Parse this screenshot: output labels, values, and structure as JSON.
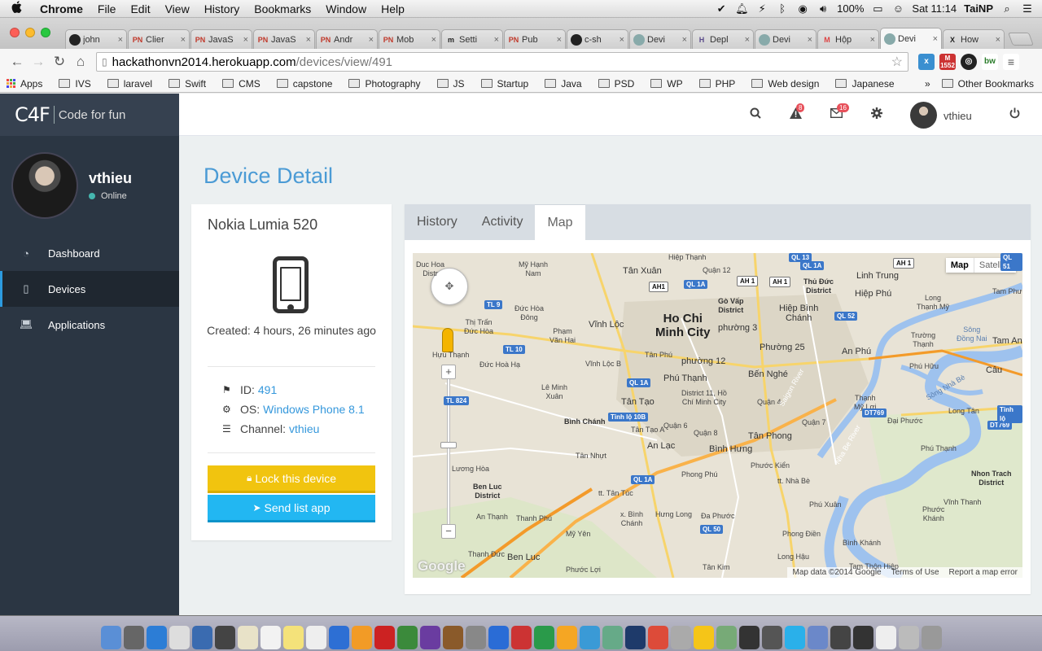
{
  "menubar": {
    "apple": "",
    "app": "Chrome",
    "items": [
      "File",
      "Edit",
      "View",
      "History",
      "Bookmarks",
      "Window",
      "Help"
    ],
    "battery": "100%",
    "clock": "Sat 11:14",
    "user": "TaiNP"
  },
  "browser": {
    "tabs": [
      {
        "label": "john",
        "icon": "github-icon",
        "favtext": "",
        "favcolor": "#222"
      },
      {
        "label": "Clier",
        "icon": "pn-icon",
        "favtext": "PN",
        "favcolor": "#c0392b"
      },
      {
        "label": "JavaS",
        "icon": "pn-icon",
        "favtext": "PN",
        "favcolor": "#c0392b"
      },
      {
        "label": "JavaS",
        "icon": "pn-icon",
        "favtext": "PN",
        "favcolor": "#c0392b"
      },
      {
        "label": "Andr",
        "icon": "pn-icon",
        "favtext": "PN",
        "favcolor": "#c0392b"
      },
      {
        "label": "Mob",
        "icon": "pn-icon",
        "favtext": "PN",
        "favcolor": "#c0392b"
      },
      {
        "label": "Setti",
        "icon": "m-icon",
        "favtext": "m",
        "favcolor": "#222"
      },
      {
        "label": "Pub",
        "icon": "pn-icon",
        "favtext": "PN",
        "favcolor": "#c0392b"
      },
      {
        "label": "c-sh",
        "icon": "github-icon",
        "favtext": "",
        "favcolor": "#222"
      },
      {
        "label": "Devi",
        "icon": "page-icon",
        "favtext": "",
        "favcolor": "#8aa"
      },
      {
        "label": "Depl",
        "icon": "heroku-icon",
        "favtext": "H",
        "favcolor": "#5a4a8a"
      },
      {
        "label": "Devi",
        "icon": "page-icon",
        "favtext": "",
        "favcolor": "#8aa"
      },
      {
        "label": "Hộp",
        "icon": "gmail-icon",
        "favtext": "M",
        "favcolor": "#d44"
      },
      {
        "label": "Devi",
        "icon": "page-icon",
        "favtext": "",
        "favcolor": "#8aa"
      },
      {
        "label": "How",
        "icon": "x-icon",
        "favtext": "X",
        "favcolor": "#222"
      }
    ],
    "active_tab": 13,
    "url_host": "hackathonvn2014.herokuapp.com",
    "url_path": "/devices/view/491",
    "gmail_count": "1552",
    "bookmarks": [
      "IVS",
      "laravel",
      "Swift",
      "CMS",
      "capstone",
      "Photography",
      "JS",
      "Startup",
      "Java",
      "PSD",
      "WP",
      "PHP",
      "Web design",
      "Japanese"
    ],
    "apps_label": "Apps",
    "overflow_label": "»",
    "other_bookmarks": "Other Bookmarks"
  },
  "app": {
    "logo_mark": "C4F",
    "logo_text": "Code for fun",
    "user": {
      "name": "vthieu",
      "status": "Online"
    },
    "nav": [
      {
        "label": "Dashboard",
        "icon": "dashboard-icon"
      },
      {
        "label": "Devices",
        "icon": "mobile-icon"
      },
      {
        "label": "Applications",
        "icon": "laptop-icon"
      }
    ],
    "active_nav": 1,
    "topbar": {
      "alerts_count": "8",
      "messages_count": "16",
      "username": "vthieu"
    },
    "page_title": "Device Detail",
    "device": {
      "name": "Nokia Lumia 520",
      "created": "Created: 4 hours, 26 minutes ago",
      "id_label": "ID:",
      "id_value": "491",
      "os_label": "OS:",
      "os_value": "Windows Phone 8.1",
      "channel_label": "Channel:",
      "channel_value": "vthieu"
    },
    "buttons": {
      "lock": "Lock this device",
      "send": "Send list app"
    },
    "tabs": [
      "History",
      "Activity",
      "Map"
    ],
    "active_tab": 2,
    "map": {
      "type_map": "Map",
      "type_satellite": "Satellite",
      "google": "Google",
      "attribution": [
        "Map data ©2014 Google",
        "Terms of Use",
        "Report a map error"
      ],
      "labels": {
        "city": "Ho Chi\nMinh City",
        "duc_hoa": "Duc Hoa\nDistr",
        "my_hanh_nam": "Mỹ Hạnh\nNam",
        "tan_xuan": "Tân Xuân",
        "hiep_thanh": "Hiệp Thạnh",
        "quan12": "Quận 12",
        "thu_duc": "Thủ Đức\nDistrict",
        "linh_trung": "Linh Trung",
        "tam_phuoc": "Tam Phướ",
        "go_vap": "Gò Vấp\nDistrict",
        "hiep_binh": "Hiệp Bình\nChánh",
        "hiep_phu": "Hiệp Phú",
        "long_thanh_my": "Long\nThạnh Mỹ",
        "duc_hoa_dong": "Đức Hòa\nĐông",
        "thi_tran": "Thị Trấn\nĐức Hòa",
        "pham_van_hai": "Phạm\nVăn Hai",
        "vinh_loc": "Vĩnh Lộc",
        "phuong3": "phường 3",
        "truong_thanh": "Trường\nThạnh",
        "tam_an": "Tam An",
        "hau_thanh": "Hựu Thạnh",
        "tan_phu": "Tân Phú",
        "phuong12": "phường 12",
        "phuong25": "Phường 25",
        "an_phu": "An Phú",
        "duc_hoa_ha": "Đức Hoà Hạ",
        "vinh_loc_b": "Vĩnh Lộc B",
        "ben_nghe": "Bến Nghé",
        "phu_huu": "Phú Hữu",
        "cau": "Câu",
        "le_minh_xuan": "Lê Minh\nXuân",
        "phu_thanh": "Phú Thạnh",
        "district11": "District 11, Hồ\nChí Minh City",
        "quan4": "Quận 4",
        "thanh_my_loi": "Thạnh\nMỹ Lợi",
        "binh_chanh": "Bình Chánh",
        "tan_tao": "Tân Tạo",
        "tan_tao_a": "Tân Tạo A",
        "quan6": "Quận 6",
        "quan8": "Quận 8",
        "quan7": "Quận 7",
        "dai_phuoc": "Đại Phước",
        "long_tan": "Long Tân",
        "tan_nhut": "Tân Nhựt",
        "an_lac": "An Lạc",
        "binh_hung": "Bình Hưng",
        "tan_phong": "Tân Phong",
        "phu_thanh2": "Phú Thạnh",
        "luong_hoa": "Lương Hòa",
        "phong_phu": "Phong Phú",
        "phuoc_kien": "Phước Kiển",
        "nhon_trach": "Nhon Trach\nDistrict",
        "ben_luc": "Ben Luc\nDistrict",
        "tt_tan_tuc": "tt. Tân Túc",
        "tt_nha_be": "tt. Nhà Bè",
        "x_binh_chanh": "x. Bình\nChánh",
        "an_thanh": "An Thạnh",
        "thanh_phu": "Thanh Phú",
        "hung_long": "Hưng Long",
        "da_phuoc": "Đa Phước",
        "phu_xuan": "Phú Xuân",
        "vinh_thanh": "Vĩnh Thanh",
        "phuoc_khanh": "Phước\nKhánh",
        "my_yen": "Mỹ Yên",
        "phong_dien": "Phong Điền",
        "binh_khanh": "Bình Khánh",
        "thanh_duc": "Thạnh Đức",
        "ben_luc2": "Ben Luc",
        "phuoc_loi": "Phước Lợi",
        "tan_kim": "Tân Kim",
        "long_hau": "Long Hậu",
        "tam_thon_hiep": "Tam Thôn Hiệp",
        "nha_be_river": "Nha Be River",
        "saigon_river": "Saigon River",
        "dong_nai": "Sông\nĐồng Nai",
        "nha_be2": "Sông Nhà Bè"
      },
      "shields": {
        "ah1_a": "AH 1",
        "ah1_b": "AH1",
        "ah1_c": "AH 1",
        "ah1_d": "AH 1",
        "ql1a_a": "QL 1A",
        "ql1a_b": "QL 1A",
        "ql1a_c": "QL 1A",
        "ql1a_d": "QL 1A",
        "ql52": "QL 52",
        "ql51": "QL 51",
        "ql13": "QL 13",
        "tl9": "TL 9",
        "tl10": "TL 10",
        "tl824": "TL 824",
        "tl10b": "Tỉnh lộ 10B",
        "ql50": "QL 50",
        "dt769": "DT769",
        "dt769b": "DT769",
        "tinh_lo": "Tỉnh lộ"
      }
    }
  }
}
